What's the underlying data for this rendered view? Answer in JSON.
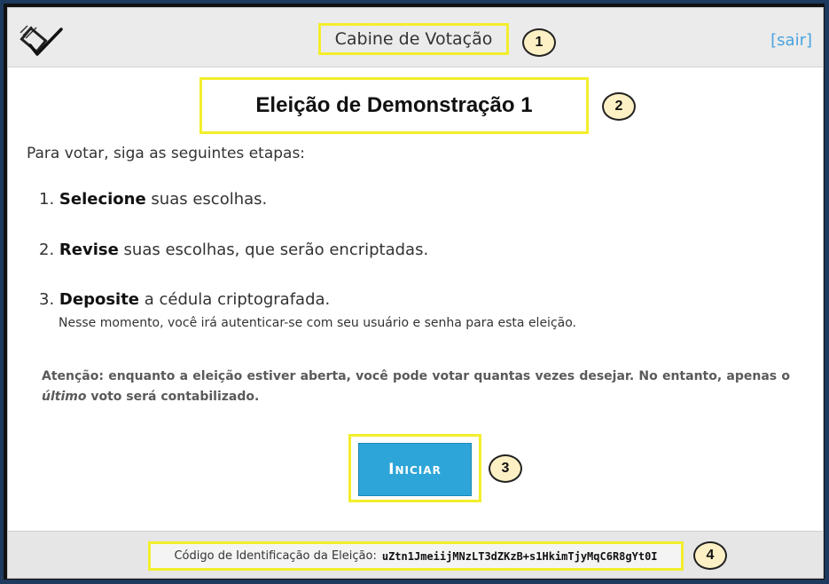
{
  "header": {
    "title": "Cabine de Votação",
    "logout_label": "[sair]",
    "logo_icon": "ballot-check-icon"
  },
  "markers": [
    "1",
    "2",
    "3",
    "4"
  ],
  "election": {
    "title": "Eleição de Demonstração 1"
  },
  "instructions": {
    "intro": "Para votar, siga as seguintes etapas:",
    "steps": [
      {
        "number": "1.",
        "bold": "Selecione",
        "rest": " suas escolhas."
      },
      {
        "number": "2.",
        "bold": "Revise",
        "rest": " suas escolhas, que serão encriptadas."
      },
      {
        "number": "3.",
        "bold": "Deposite",
        "rest": " a cédula criptografada."
      }
    ],
    "step3_note": "Nesse momento, você irá autenticar-se com seu usuário e senha para esta eleição."
  },
  "warning": {
    "part1": "Atenção: enquanto a eleição estiver aberta, você pode votar quantas vezes desejar. No entanto, apenas o ",
    "emphasis": "último",
    "part2": " voto será contabilizado."
  },
  "start_button": {
    "label": "Iniciar"
  },
  "footer": {
    "code_label": "Código de Identificação da Eleição:",
    "code_value": "uZtn1JmeiijMNzLT3dZKzB+s1HkimTjyMqC6R8gYt0I"
  },
  "colors": {
    "highlight": "#f3ee2c",
    "button": "#2ea5d8",
    "link": "#4aa3df",
    "marker_fill": "#fdf0c4"
  }
}
